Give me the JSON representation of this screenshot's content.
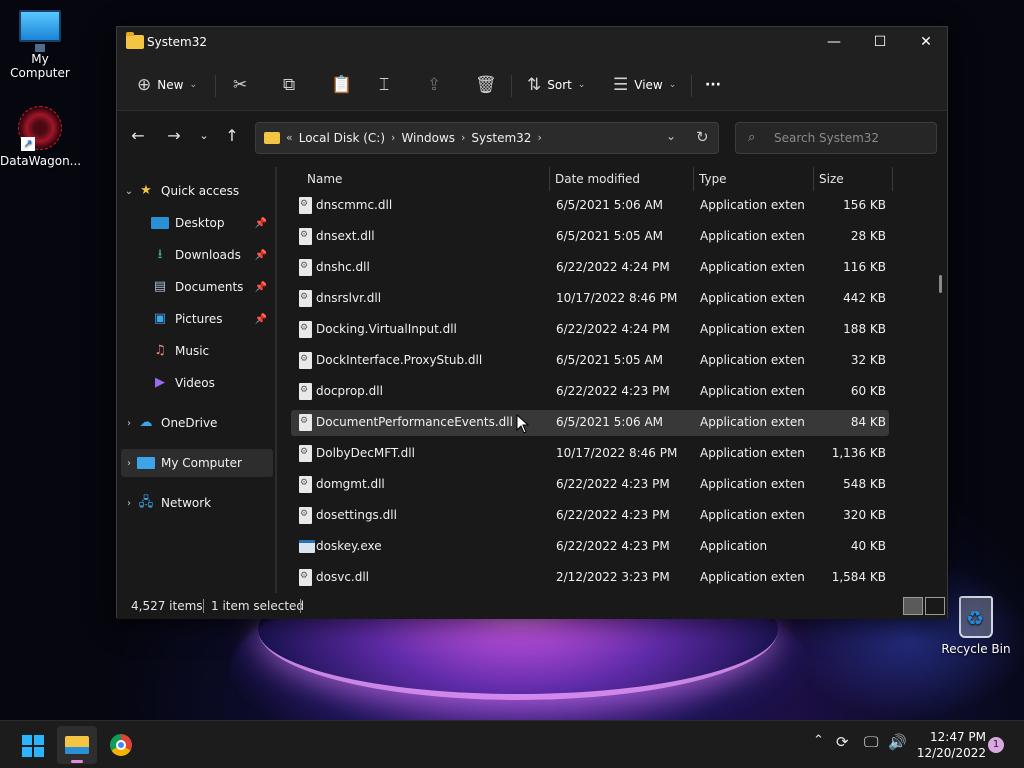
{
  "desktop": {
    "icons": [
      {
        "label": "My Computer"
      },
      {
        "label": "DataWagon..."
      },
      {
        "label": "Recycle Bin"
      }
    ]
  },
  "window": {
    "title": "System32",
    "controls": {
      "minimize": "—",
      "maximize": "☐",
      "close": "✕"
    }
  },
  "toolbar": {
    "new_label": "New",
    "sort_label": "Sort",
    "view_label": "View",
    "more_label": "···"
  },
  "address": {
    "prefix": "«",
    "crumbs": [
      "Local Disk (C:)",
      "Windows",
      "System32"
    ],
    "separator": "›"
  },
  "search": {
    "placeholder": "Search System32"
  },
  "sidebar": {
    "quick_access": "Quick access",
    "items": [
      {
        "label": "Desktop",
        "pinned": true
      },
      {
        "label": "Downloads",
        "pinned": true
      },
      {
        "label": "Documents",
        "pinned": true
      },
      {
        "label": "Pictures",
        "pinned": true
      },
      {
        "label": "Music",
        "pinned": false
      },
      {
        "label": "Videos",
        "pinned": false
      }
    ],
    "onedrive": "OneDrive",
    "my_computer": "My Computer",
    "network": "Network"
  },
  "columns": {
    "name": "Name",
    "date": "Date modified",
    "type": "Type",
    "size": "Size"
  },
  "files": [
    {
      "name": "dnscmmc.dll",
      "date": "6/5/2021 5:06 AM",
      "type": "Application exten...",
      "size": "156 KB",
      "kind": "dll"
    },
    {
      "name": "dnsext.dll",
      "date": "6/5/2021 5:05 AM",
      "type": "Application exten...",
      "size": "28 KB",
      "kind": "dll"
    },
    {
      "name": "dnshc.dll",
      "date": "6/22/2022 4:24 PM",
      "type": "Application exten...",
      "size": "116 KB",
      "kind": "dll"
    },
    {
      "name": "dnsrslvr.dll",
      "date": "10/17/2022 8:46 PM",
      "type": "Application exten...",
      "size": "442 KB",
      "kind": "dll"
    },
    {
      "name": "Docking.VirtualInput.dll",
      "date": "6/22/2022 4:24 PM",
      "type": "Application exten...",
      "size": "188 KB",
      "kind": "dll"
    },
    {
      "name": "DockInterface.ProxyStub.dll",
      "date": "6/5/2021 5:05 AM",
      "type": "Application exten...",
      "size": "32 KB",
      "kind": "dll"
    },
    {
      "name": "docprop.dll",
      "date": "6/22/2022 4:23 PM",
      "type": "Application exten...",
      "size": "60 KB",
      "kind": "dll"
    },
    {
      "name": "DocumentPerformanceEvents.dll",
      "date": "6/5/2021 5:06 AM",
      "type": "Application exten...",
      "size": "84 KB",
      "kind": "dll",
      "selected": true
    },
    {
      "name": "DolbyDecMFT.dll",
      "date": "10/17/2022 8:46 PM",
      "type": "Application exten...",
      "size": "1,136 KB",
      "kind": "dll"
    },
    {
      "name": "domgmt.dll",
      "date": "6/22/2022 4:23 PM",
      "type": "Application exten...",
      "size": "548 KB",
      "kind": "dll"
    },
    {
      "name": "dosettings.dll",
      "date": "6/22/2022 4:23 PM",
      "type": "Application exten...",
      "size": "320 KB",
      "kind": "dll"
    },
    {
      "name": "doskey.exe",
      "date": "6/22/2022 4:23 PM",
      "type": "Application",
      "size": "40 KB",
      "kind": "exe"
    },
    {
      "name": "dosvc.dll",
      "date": "2/12/2022 3:23 PM",
      "type": "Application exten...",
      "size": "1,584 KB",
      "kind": "dll"
    }
  ],
  "status": {
    "items": "4,527 items",
    "selected": "1 item selected"
  },
  "taskbar": {
    "time": "12:47 PM",
    "date": "12/20/2022",
    "notifications": "1"
  }
}
